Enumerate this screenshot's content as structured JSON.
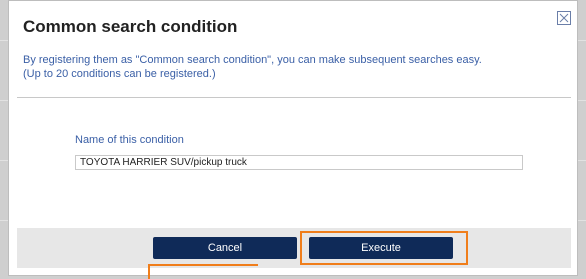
{
  "modal": {
    "title": "Common search condition",
    "intro_line1": "By registering them as \"Common search condition\", you can make subsequent searches easy.",
    "intro_line2": "(Up to 20 conditions can be registered.)"
  },
  "form": {
    "label": "Name of this condition",
    "value": "TOYOTA HARRIER SUV/pickup truck"
  },
  "buttons": {
    "cancel": "Cancel",
    "execute": "Execute"
  },
  "icons": {
    "close": "close-icon"
  },
  "colors": {
    "accent": "#0f2a58",
    "highlight": "#f07e1b",
    "link_text": "#3a5fa6"
  }
}
